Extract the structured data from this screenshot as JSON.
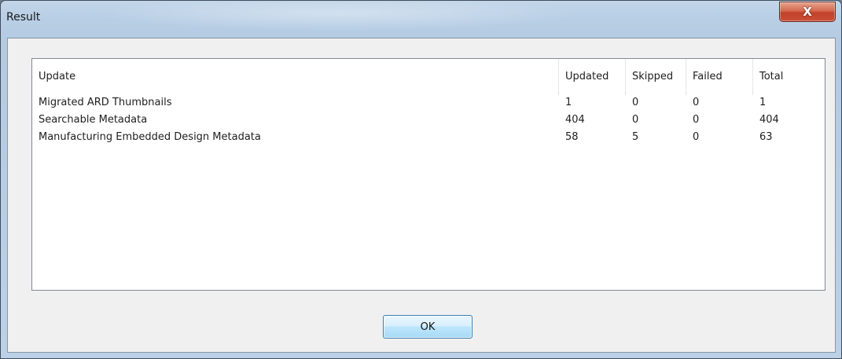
{
  "window": {
    "title": "Result",
    "close_glyph": "X"
  },
  "table": {
    "columns": [
      "Update",
      "Updated",
      "Skipped",
      "Failed",
      "Total"
    ],
    "rows": [
      [
        "Migrated ARD Thumbnails",
        "1",
        "0",
        "0",
        "1"
      ],
      [
        "Searchable Metadata",
        "404",
        "0",
        "0",
        "404"
      ],
      [
        "Manufacturing Embedded Design Metadata",
        "58",
        "5",
        "0",
        "63"
      ]
    ]
  },
  "buttons": {
    "ok_label": "OK"
  },
  "icons": {
    "close": "close-icon"
  },
  "colors": {
    "close_button": "#c94e36",
    "ok_button_border": "#3c7fb1",
    "dialog_background": "#f0f0f0"
  }
}
